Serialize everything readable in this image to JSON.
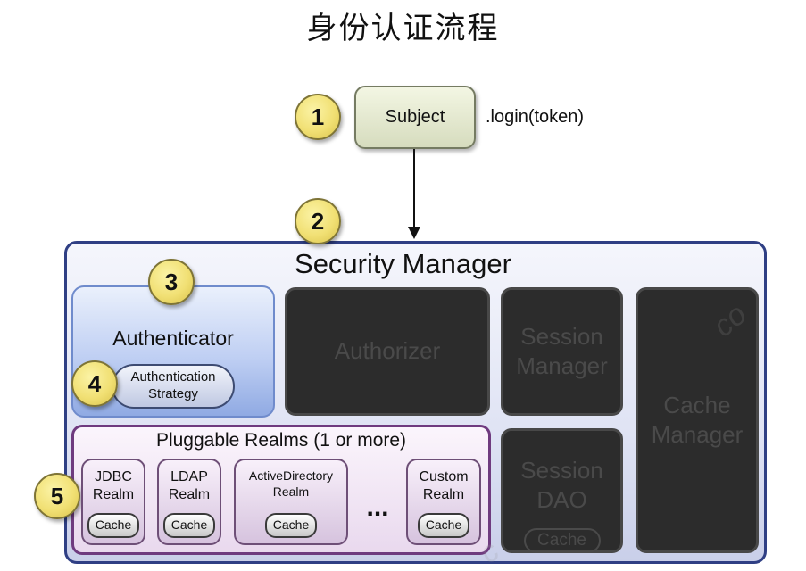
{
  "title": "身份认证流程",
  "steps": [
    "1",
    "2",
    "3",
    "4",
    "5"
  ],
  "subject": {
    "label": "Subject",
    "call": ".login(token)"
  },
  "security_manager": {
    "label": "Security Manager"
  },
  "authenticator": {
    "label": "Authenticator",
    "strategy": "Authentication\nStrategy"
  },
  "authorizer": {
    "label": "Authorizer"
  },
  "session_manager": {
    "label": "Session\nManager"
  },
  "session_dao": {
    "label": "Session\nDAO",
    "cache": "Cache"
  },
  "cache_manager": {
    "label": "Cache\nManager"
  },
  "realms": {
    "title": "Pluggable Realms (1 or more)",
    "ellipsis": "...",
    "items": [
      {
        "name": "JDBC\nRealm",
        "cache": "Cache"
      },
      {
        "name": "LDAP\nRealm",
        "cache": "Cache"
      },
      {
        "name": "ActiveDirectory\nRealm",
        "cache": "Cache"
      },
      {
        "name": "Custom\nRealm",
        "cache": "Cache"
      }
    ]
  },
  "colors": {
    "step_circle": "#f1e074",
    "security_manager_border": "#2f3f84",
    "authenticator_fill": "#bfcff3",
    "inactive_fill": "#2c2c2c",
    "realms_border": "#6f3b7f"
  }
}
